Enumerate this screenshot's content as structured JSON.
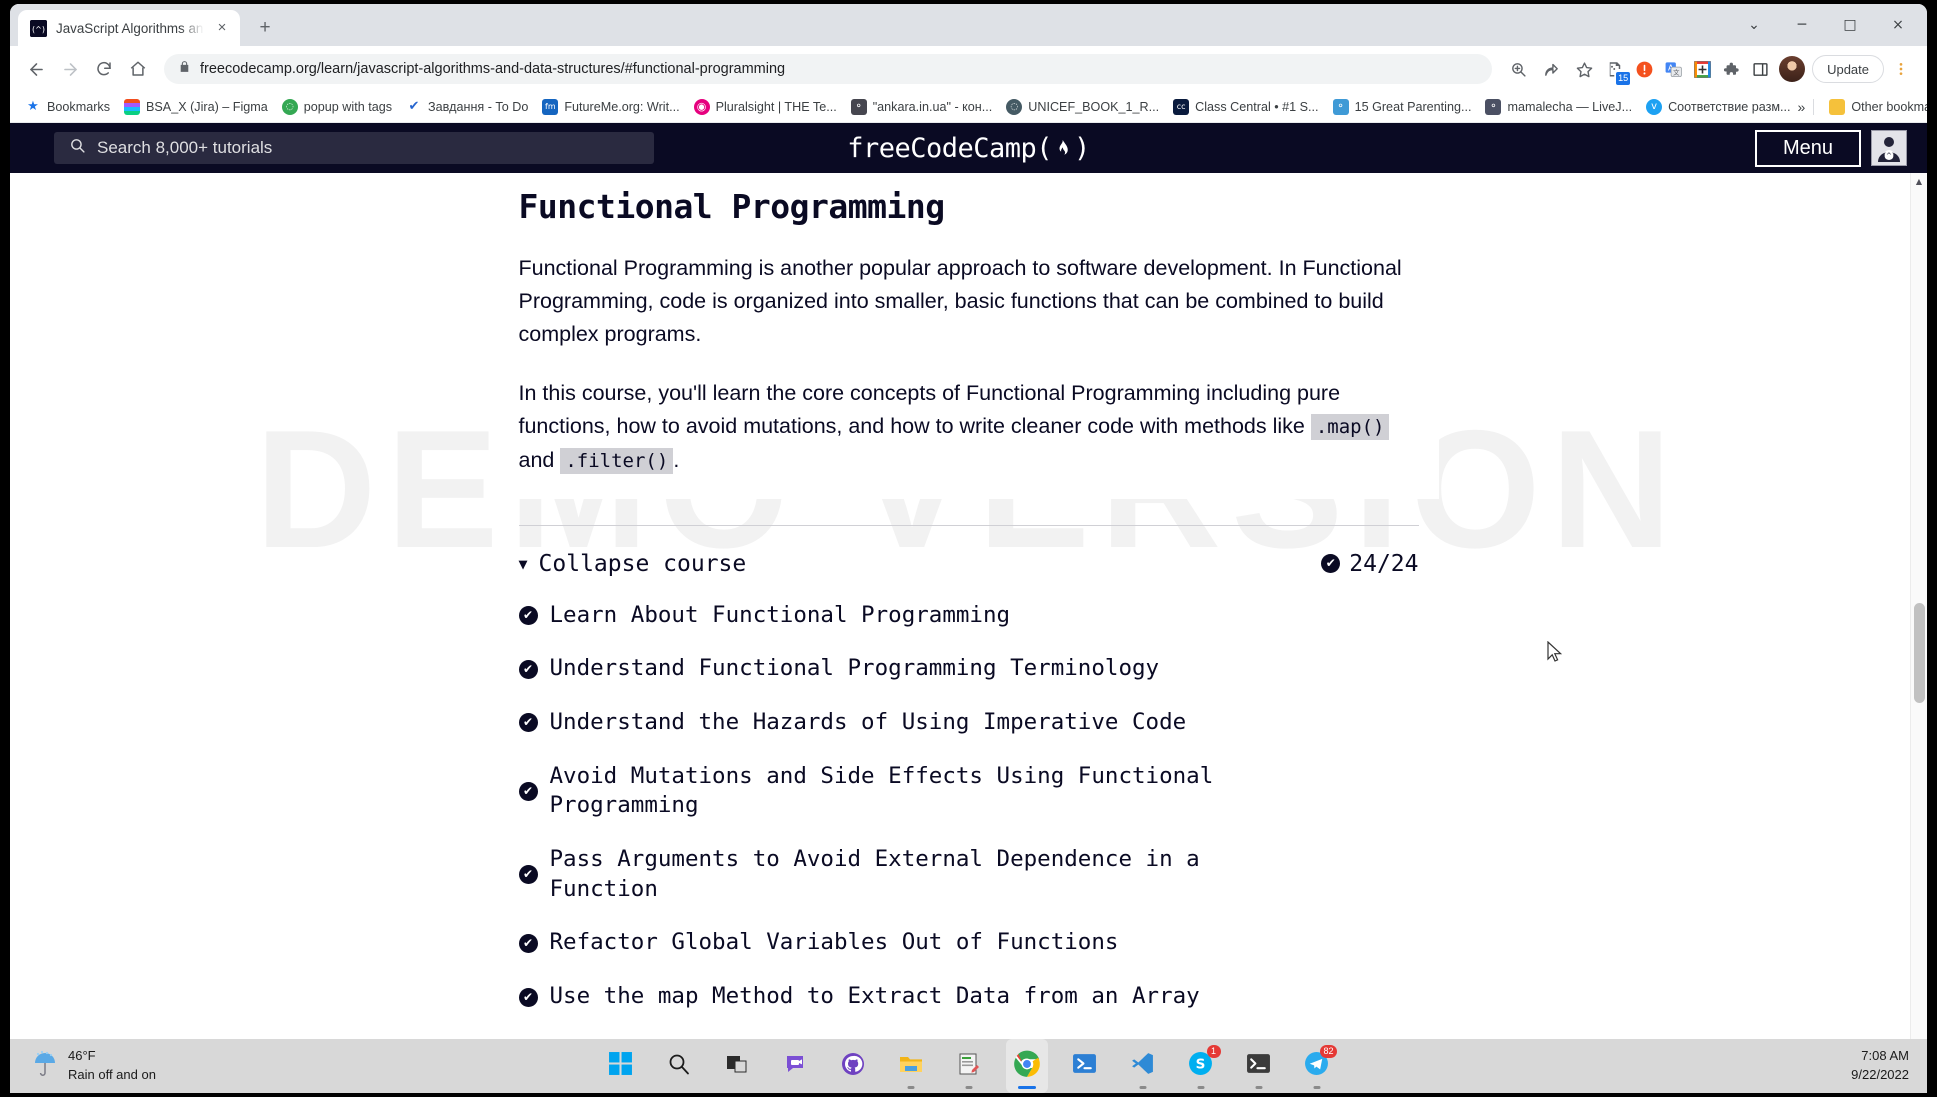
{
  "browser": {
    "tab": {
      "title": "JavaScript Algorithms and Data S",
      "favicon": "fcc-favicon",
      "close_label": "×"
    },
    "newtab_label": "+",
    "window_controls": {
      "chevron": "⌄",
      "minimize": "─",
      "maximize": "□",
      "close": "×"
    },
    "nav": {
      "back": "←",
      "forward": "→",
      "reload": "↻",
      "home": "⌂"
    },
    "omnibox": {
      "lock": "🔒",
      "host": "freecodecamp.org",
      "path": "/learn/javascript-algorithms-and-data-structures/#functional-programming",
      "full_url": "freecodecamp.org/learn/javascript-algorithms-and-data-structures/#functional-programming"
    },
    "toolbar_right": {
      "zoom_label": "⊕",
      "share_label": "↱",
      "bookmark_star": "☆",
      "ext_counter_badge": "15",
      "update_label": "Update",
      "menu_label": "⋮"
    },
    "bookmarks": [
      {
        "label": "Bookmarks",
        "icon": "star-icon",
        "color": "#1a73e8"
      },
      {
        "label": "BSA_X (Jira) – Figma",
        "icon": "figma-icon",
        "color": "#f24e1e"
      },
      {
        "label": "popup with tags",
        "icon": "globe-icon",
        "color": "#34a853"
      },
      {
        "label": "Завдання - To Do",
        "icon": "check-icon",
        "color": "#2564cf"
      },
      {
        "label": "FutureMe.org: Writ...",
        "icon": "fm-icon",
        "color": "#1565c0"
      },
      {
        "label": "Pluralsight | THE Te...",
        "icon": "pluralsight-icon",
        "color": "#e6007e"
      },
      {
        "label": "\"ankara.in.ua\" - кон...",
        "icon": "avatar-icon",
        "color": "#46464f"
      },
      {
        "label": "UNICEF_BOOK_1_R...",
        "icon": "globe-icon",
        "color": "#455a64"
      },
      {
        "label": "Class Central • #1 S...",
        "icon": "cc-icon",
        "color": "#0a1b3d"
      },
      {
        "label": "15 Great Parenting...",
        "icon": "person-icon",
        "color": "#3f9ad6"
      },
      {
        "label": "mamalecha — LiveJ...",
        "icon": "avatar-icon",
        "color": "#4b5063"
      },
      {
        "label": "Соответствие разм...",
        "icon": "bird-icon",
        "color": "#1da1f2"
      }
    ],
    "bookmarks_overflow": {
      "chevron": "»",
      "other_label": "Other bookmarks",
      "folder_icon": "folder-icon"
    }
  },
  "fcc": {
    "search": {
      "placeholder": "Search 8,000+ tutorials",
      "icon": "search-icon"
    },
    "logo_text": "freeCodeCamp(",
    "logo_flame": "🔥",
    "logo_text_end": ")",
    "menu_label": "Menu",
    "avatar_name": "user-avatar"
  },
  "watermark": "DEMO VERSION",
  "page": {
    "title": "Functional Programming",
    "paragraph_1": "Functional Programming is another popular approach to software development. In Functional Programming, code is organized into smaller, basic functions that can be combined to build complex programs.",
    "paragraph_2_part_1": "In this course, you'll learn the core concepts of Functional Programming including pure functions, how to avoid mutations, and how to write cleaner code with methods like ",
    "code_1": ".map()",
    "paragraph_2_part_2": " and ",
    "code_2": ".filter()",
    "paragraph_2_part_3": ".",
    "collapse_label": "Collapse course",
    "collapse_caret": "▼",
    "progress_text": "24/24",
    "check_glyph": "✔",
    "challenges": [
      "Learn About Functional Programming",
      "Understand Functional Programming Terminology",
      "Understand the Hazards of Using Imperative Code",
      "Avoid Mutations and Side Effects Using Functional Programming",
      "Pass Arguments to Avoid External Dependence in a Function",
      "Refactor Global Variables Out of Functions",
      "Use the map Method to Extract Data from an Array"
    ]
  },
  "scrollbar": {
    "up_arrow": "▲",
    "down_arrow": "▼"
  },
  "taskbar": {
    "weather": {
      "temperature": "46°F",
      "condition": "Rain off and on",
      "icon": "umbrella-rain-icon"
    },
    "apps": [
      {
        "name": "start-button",
        "icon": "windows-icon",
        "badge": "",
        "active": false,
        "running": false
      },
      {
        "name": "search-taskbar",
        "icon": "search-icon",
        "badge": "",
        "active": false,
        "running": false
      },
      {
        "name": "task-view",
        "icon": "task-view-icon",
        "badge": "",
        "active": false,
        "running": false
      },
      {
        "name": "teams",
        "icon": "teams-chat-icon",
        "badge": "",
        "active": false,
        "running": false
      },
      {
        "name": "github-desktop",
        "icon": "github-icon",
        "badge": "",
        "active": false,
        "running": false
      },
      {
        "name": "file-explorer",
        "icon": "folder-icon",
        "badge": "",
        "active": false,
        "running": true
      },
      {
        "name": "notepad-plus-plus",
        "icon": "notepad-icon",
        "badge": "",
        "active": false,
        "running": true
      },
      {
        "name": "google-chrome",
        "icon": "chrome-icon",
        "badge": "",
        "active": true,
        "running": true
      },
      {
        "name": "powershell",
        "icon": "powershell-icon",
        "badge": "",
        "active": false,
        "running": false
      },
      {
        "name": "visual-studio-code",
        "icon": "vscode-icon",
        "badge": "",
        "active": false,
        "running": true
      },
      {
        "name": "skype",
        "icon": "skype-icon",
        "badge": "1",
        "active": false,
        "running": true
      },
      {
        "name": "windows-terminal",
        "icon": "terminal-icon",
        "badge": "",
        "active": false,
        "running": true
      },
      {
        "name": "telegram",
        "icon": "telegram-icon",
        "badge": "82",
        "active": false,
        "running": true
      }
    ],
    "clock": {
      "time": "7:08 AM",
      "date": "9/22/2022"
    }
  }
}
